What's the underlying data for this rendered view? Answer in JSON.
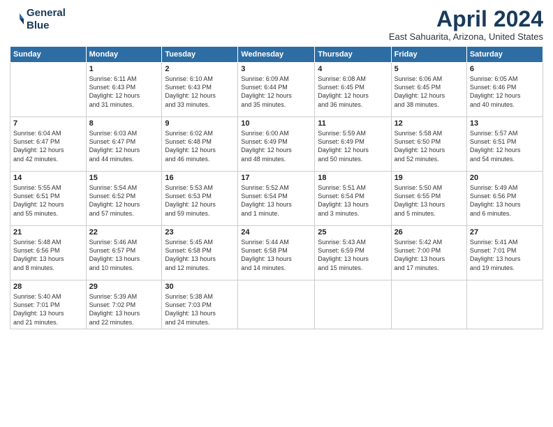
{
  "header": {
    "logo_line1": "General",
    "logo_line2": "Blue",
    "month_title": "April 2024",
    "location": "East Sahuarita, Arizona, United States"
  },
  "days_of_week": [
    "Sunday",
    "Monday",
    "Tuesday",
    "Wednesday",
    "Thursday",
    "Friday",
    "Saturday"
  ],
  "weeks": [
    [
      {
        "day": "",
        "info": ""
      },
      {
        "day": "1",
        "info": "Sunrise: 6:11 AM\nSunset: 6:43 PM\nDaylight: 12 hours\nand 31 minutes."
      },
      {
        "day": "2",
        "info": "Sunrise: 6:10 AM\nSunset: 6:43 PM\nDaylight: 12 hours\nand 33 minutes."
      },
      {
        "day": "3",
        "info": "Sunrise: 6:09 AM\nSunset: 6:44 PM\nDaylight: 12 hours\nand 35 minutes."
      },
      {
        "day": "4",
        "info": "Sunrise: 6:08 AM\nSunset: 6:45 PM\nDaylight: 12 hours\nand 36 minutes."
      },
      {
        "day": "5",
        "info": "Sunrise: 6:06 AM\nSunset: 6:45 PM\nDaylight: 12 hours\nand 38 minutes."
      },
      {
        "day": "6",
        "info": "Sunrise: 6:05 AM\nSunset: 6:46 PM\nDaylight: 12 hours\nand 40 minutes."
      }
    ],
    [
      {
        "day": "7",
        "info": "Sunrise: 6:04 AM\nSunset: 6:47 PM\nDaylight: 12 hours\nand 42 minutes."
      },
      {
        "day": "8",
        "info": "Sunrise: 6:03 AM\nSunset: 6:47 PM\nDaylight: 12 hours\nand 44 minutes."
      },
      {
        "day": "9",
        "info": "Sunrise: 6:02 AM\nSunset: 6:48 PM\nDaylight: 12 hours\nand 46 minutes."
      },
      {
        "day": "10",
        "info": "Sunrise: 6:00 AM\nSunset: 6:49 PM\nDaylight: 12 hours\nand 48 minutes."
      },
      {
        "day": "11",
        "info": "Sunrise: 5:59 AM\nSunset: 6:49 PM\nDaylight: 12 hours\nand 50 minutes."
      },
      {
        "day": "12",
        "info": "Sunrise: 5:58 AM\nSunset: 6:50 PM\nDaylight: 12 hours\nand 52 minutes."
      },
      {
        "day": "13",
        "info": "Sunrise: 5:57 AM\nSunset: 6:51 PM\nDaylight: 12 hours\nand 54 minutes."
      }
    ],
    [
      {
        "day": "14",
        "info": "Sunrise: 5:55 AM\nSunset: 6:51 PM\nDaylight: 12 hours\nand 55 minutes."
      },
      {
        "day": "15",
        "info": "Sunrise: 5:54 AM\nSunset: 6:52 PM\nDaylight: 12 hours\nand 57 minutes."
      },
      {
        "day": "16",
        "info": "Sunrise: 5:53 AM\nSunset: 6:53 PM\nDaylight: 12 hours\nand 59 minutes."
      },
      {
        "day": "17",
        "info": "Sunrise: 5:52 AM\nSunset: 6:54 PM\nDaylight: 13 hours\nand 1 minute."
      },
      {
        "day": "18",
        "info": "Sunrise: 5:51 AM\nSunset: 6:54 PM\nDaylight: 13 hours\nand 3 minutes."
      },
      {
        "day": "19",
        "info": "Sunrise: 5:50 AM\nSunset: 6:55 PM\nDaylight: 13 hours\nand 5 minutes."
      },
      {
        "day": "20",
        "info": "Sunrise: 5:49 AM\nSunset: 6:56 PM\nDaylight: 13 hours\nand 6 minutes."
      }
    ],
    [
      {
        "day": "21",
        "info": "Sunrise: 5:48 AM\nSunset: 6:56 PM\nDaylight: 13 hours\nand 8 minutes."
      },
      {
        "day": "22",
        "info": "Sunrise: 5:46 AM\nSunset: 6:57 PM\nDaylight: 13 hours\nand 10 minutes."
      },
      {
        "day": "23",
        "info": "Sunrise: 5:45 AM\nSunset: 6:58 PM\nDaylight: 13 hours\nand 12 minutes."
      },
      {
        "day": "24",
        "info": "Sunrise: 5:44 AM\nSunset: 6:58 PM\nDaylight: 13 hours\nand 14 minutes."
      },
      {
        "day": "25",
        "info": "Sunrise: 5:43 AM\nSunset: 6:59 PM\nDaylight: 13 hours\nand 15 minutes."
      },
      {
        "day": "26",
        "info": "Sunrise: 5:42 AM\nSunset: 7:00 PM\nDaylight: 13 hours\nand 17 minutes."
      },
      {
        "day": "27",
        "info": "Sunrise: 5:41 AM\nSunset: 7:01 PM\nDaylight: 13 hours\nand 19 minutes."
      }
    ],
    [
      {
        "day": "28",
        "info": "Sunrise: 5:40 AM\nSunset: 7:01 PM\nDaylight: 13 hours\nand 21 minutes."
      },
      {
        "day": "29",
        "info": "Sunrise: 5:39 AM\nSunset: 7:02 PM\nDaylight: 13 hours\nand 22 minutes."
      },
      {
        "day": "30",
        "info": "Sunrise: 5:38 AM\nSunset: 7:03 PM\nDaylight: 13 hours\nand 24 minutes."
      },
      {
        "day": "",
        "info": ""
      },
      {
        "day": "",
        "info": ""
      },
      {
        "day": "",
        "info": ""
      },
      {
        "day": "",
        "info": ""
      }
    ]
  ]
}
